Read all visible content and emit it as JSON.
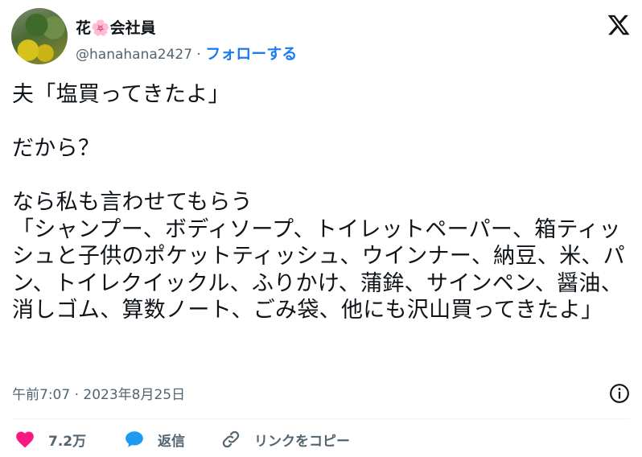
{
  "author": {
    "display_name": "花🌸会社員",
    "handle": "@hanahana2427",
    "separator": " · ",
    "follow_label": "フォローする"
  },
  "tweet": {
    "text": "夫「塩買ってきたよ」\n\nだから？\n\nなら私も言わせてもらう\n「シャンプー、ボディソープ、トイレットペーパー、箱ティッシュと子供のポケットティッシュ、ウインナー、納豆、米、パン、トイレクイックル、ふりかけ、蒲鉾、サインペン、醤油、消しゴム、算数ノート、ごみ袋、他にも沢山買ってきたよ」",
    "timestamp": "午前7:07 · 2023年8月25日"
  },
  "actions": {
    "like_count": "7.2万",
    "reply_label": "返信",
    "copy_link_label": "リンクをコピー"
  },
  "icons": {
    "logo": "x-logo-icon",
    "info": "info-icon",
    "like": "heart-icon",
    "reply": "speech-bubble-icon",
    "copy": "link-icon"
  },
  "colors": {
    "like": "#f91880",
    "reply": "#1d9bf0",
    "follow": "#1d7bf0",
    "muted": "#536471"
  }
}
